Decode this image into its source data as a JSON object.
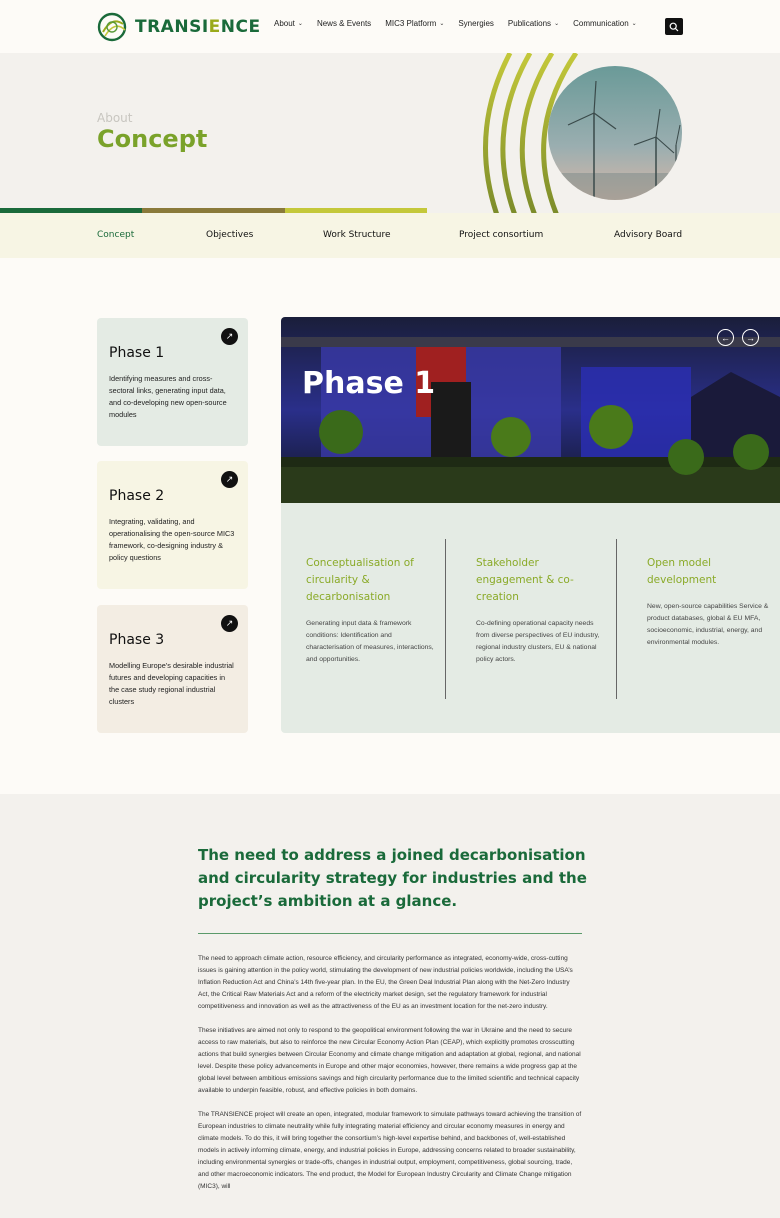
{
  "header": {
    "logo_text": "TRANSIENCE",
    "nav": [
      {
        "label": "About",
        "has_dropdown": true
      },
      {
        "label": "News & Events",
        "has_dropdown": false
      },
      {
        "label": "MIC3 Platform",
        "has_dropdown": true
      },
      {
        "label": "Synergies",
        "has_dropdown": false
      },
      {
        "label": "Publications",
        "has_dropdown": true
      },
      {
        "label": "Communication",
        "has_dropdown": true
      }
    ],
    "search_icon": "search-icon"
  },
  "hero": {
    "eyebrow": "About",
    "title": "Concept"
  },
  "colors": {
    "dark_green": "#1a6a3a",
    "brown": "#8a7a3a",
    "lime": "#c4c83a",
    "accent_green": "#7aa22a"
  },
  "tabs": [
    {
      "label": "Concept",
      "active": true
    },
    {
      "label": "Objectives",
      "active": false
    },
    {
      "label": "Work Structure",
      "active": false
    },
    {
      "label": "Project consortium",
      "active": false
    },
    {
      "label": "Advisory Board",
      "active": false
    }
  ],
  "phases": [
    {
      "title": "Phase 1",
      "text": "Identifying measures and cross-sectoral links, generating input data, and co-developing new open-source modules"
    },
    {
      "title": "Phase 2",
      "text": "Integrating, validating, and operationalising the open-source MIC3 framework, co-designing industry & policy questions"
    },
    {
      "title": "Phase 3",
      "text": "Modelling Europe’s desirable industrial futures and developing capacities in the case study regional industrial clusters"
    }
  ],
  "panel": {
    "title": "Phase 1",
    "columns": [
      {
        "heading": "Conceptualisation of circularity & decarbonisation",
        "text": "Generating input data & framework conditions: Identification and characterisation of measures, interactions, and opportunities."
      },
      {
        "heading": "Stakeholder engagement & co-creation",
        "text": "Co-defining operational capacity needs from diverse perspectives of EU industry, regional industry clusters, EU & national policy actors."
      },
      {
        "heading": "Open model development",
        "text": "New, open-source capabilities Service & product databases, global & EU MFA, socioeconomic, industrial, energy, and environmental modules."
      }
    ]
  },
  "section2": {
    "heading": "The need to address a joined decarbonisation and circularity strategy for industries and the project’s ambition at a glance.",
    "paragraphs": [
      "The need to approach climate action, resource efficiency, and circularity performance as integrated, economy-wide, cross-cutting issues is gaining attention in the policy world, stimulating the development of new industrial policies worldwide, including the USA’s Inflation Reduction Act and China’s 14th five-year plan. In the EU, the Green Deal Industrial Plan along with the Net-Zero Industry Act, the Critical Raw Materials Act and a reform of the electricity market design, set the regulatory framework for industrial competitiveness and innovation as well as the attractiveness of the EU as an investment location for the net-zero industry.",
      "These initiatives are aimed not only to respond to the geopolitical environment following the war in Ukraine and the need to secure access to raw materials, but also to reinforce the new Circular Economy Action Plan (CEAP), which explicitly promotes crosscutting actions that build synergies between Circular Economy and climate change mitigation and adaptation at global, regional, and national level. Despite these policy advancements in Europe and other major economies, however, there remains a wide progress gap at the global level between ambitious emissions savings and high circularity performance due to the limited scientific and technical capacity available to underpin feasible, robust, and effective policies in both domains.",
      "The TRANSIENCE project will create an open, integrated, modular framework to simulate pathways toward achieving the transition of European industries to climate neutrality while fully integrating material efficiency and circular economy measures in energy and climate models. To do this, it will bring together the consortium’s high-level expertise behind, and backbones of, well-established models in actively informing climate, energy, and industrial policies in Europe, addressing concerns related to broader sustainability, including environmental synergies or trade-offs, changes in industrial output, employment, competitiveness, global sourcing, trade, and other macroeconomic indicators. The end product, the Model for European Industry Circularity and Climate Change mitigation (MIC3), will"
    ]
  }
}
